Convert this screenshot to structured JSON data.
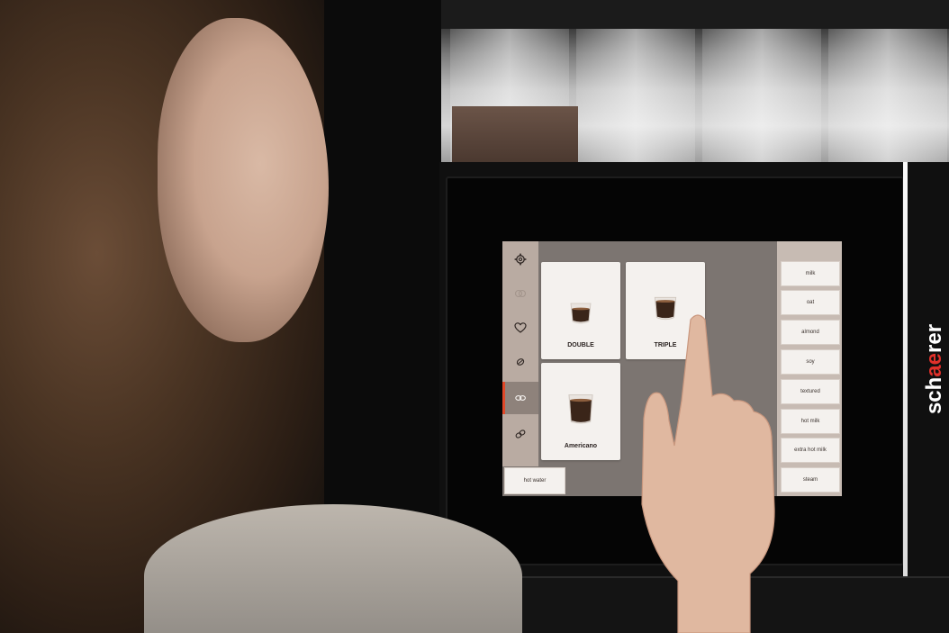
{
  "brand": {
    "name_start": "sch",
    "name_accent": "ae",
    "name_end": "rer",
    "accent_color": "#e0302a"
  },
  "sidebar": {
    "items": [
      {
        "icon": "gear-icon"
      },
      {
        "icon": "drinks-icon"
      },
      {
        "icon": "heart-icon"
      },
      {
        "icon": "bean-icon"
      },
      {
        "icon": "coffee-beans-icon",
        "active": true
      },
      {
        "icon": "double-beans-icon"
      }
    ]
  },
  "drinks": {
    "tiles": [
      {
        "label": "DOUBLE"
      },
      {
        "label": "TRIPLE"
      },
      {
        "label": "Americano"
      }
    ]
  },
  "milk_options": [
    "milk",
    "oat",
    "almond",
    "soy",
    "textured",
    "hot milk",
    "extra hot milk",
    "steam"
  ],
  "bottom": {
    "hot_water_label": "hot water"
  },
  "colors": {
    "screen_bg": "#7c7571",
    "sidebar_bg": "#b9aba2",
    "panel_bg": "#c7bbb3",
    "tile_bg": "#f4f1ee",
    "active_accent": "#e0492a"
  }
}
